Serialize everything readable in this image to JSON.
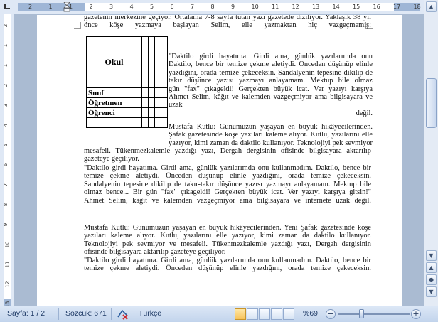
{
  "ruler": {
    "top_numbers": [
      "2",
      "1",
      "1",
      "2",
      "3",
      "4",
      "5",
      "6",
      "7",
      "8",
      "9",
      "10",
      "11",
      "12",
      "13",
      "14",
      "15",
      "16",
      "17",
      "18"
    ],
    "left_numbers": [
      "2",
      "1",
      "1",
      "2",
      "3",
      "4",
      "5",
      "6",
      "7",
      "8",
      "9",
      "10",
      "11",
      "12",
      "13"
    ]
  },
  "document": {
    "intro_lines": [
      "gazetenin merkezine geçiyor. Ortalama 7-8 sayfa tutan yazı gazetede diziliyor. Yaklaşık 38 yıl",
      "önce köşe yazmaya başlayan Selim, elle yazmaktan hiç vazgeçmemiş:"
    ],
    "table": {
      "rows": [
        "Okul",
        "Sınıf",
        "Öğretmen",
        "Öğrenci"
      ]
    },
    "side_quote_lines": [
      "\"Daktilo girdi hayatıma. Girdi ama, günlük yazılarımda onu kullanmadım.",
      "Daktilo, bence bir temize çekme aletiydi. Onceden düşünüp elinle",
      "yazdığını, orada temize çekeceksin. Sandalyenin tepesine dikilip de takır-",
      "takır düşünce yazısı yazmayı anlayamam. Mektup bile olmaz bence... Bir",
      "gün \"fax\" çıkageldi! Gerçekten büyük icat. Ver yazıyı karşıya gitsin!\"",
      "Ahmet Selim, kâğıt ve kalemden vazgeçmiyor ama bilgisayara ve internete",
      "uzak",
      "değil."
    ],
    "p1_lines": [
      "Mustafa Kutlu: Günümüzün yaşayan en büyük hikâyecilerinden. Yeni",
      "Şafak gazetesinde köşe yazıları kaleme alıyor. Kutlu, yazılarını elle",
      "yazıyor, kimi zaman da daktilo kullanıyor. Teknolojiyi pek sevmiyor ve",
      "mesafeli. Tükenmezkalemle yazdığı yazı, Dergah dergisinin ofisinde bilgisayara aktarılıp",
      "gazeteye geçiliyor."
    ],
    "q1_lines": [
      "\"Daktilo girdi hayatıma. Girdi ama, günlük yazılarımda onu kullanmadım. Daktilo, bence bir",
      "temize çekme aletiydi. Önceden düşünüp elinle yazdığını, orada temize çekeceksin.",
      "Sandalyenin tepesine dikilip de takır-takır düşünce yazısı yazmayı anlayamam. Mektup bile",
      "olmaz bence... Bir gün \"fax\" çıkageldi! Gerçekten büyük icat. Ver yazıyı karşıya gitsin!\"",
      "Ahmet Selim, kâğıt ve kalemden vazgeçmiyor ama bilgisayara ve internete uzak değil."
    ],
    "p2_lines": [
      "Mustafa Kutlu: Günümüzün yaşayan en büyük hikâyecilerinden. Yeni Şafak gazetesinde köşe",
      "yazıları kaleme alıyor. Kutlu, yazılarını elle yazıyor, kimi zaman da daktilo kullanıyor.",
      "Teknolojiyi pek sevmiyor ve mesafeli. Tükenmezkalemle yazdığı yazı, Dergah dergisinin",
      "ofisinde bilgisayara aktarılıp gazeteye geçiliyor."
    ],
    "q2_lines": [
      "\"Daktilo girdi hayatıma. Girdi ama, günlük yazılarımda onu kullanmadım. Daktilo, bence bir",
      "temize çekme aletiydi. Önceden düşünüp elinle yazdığını, orada temize çekeceksin."
    ]
  },
  "status_bar": {
    "page": "Sayfa: 1 / 2",
    "words": "Sözcük: 671",
    "language": "Türkçe",
    "zoom": "%69"
  },
  "scrollbar": {
    "up_icon": "▲",
    "down_icon": "▼",
    "prev_icon": "▲",
    "browse_icon": "●",
    "next_icon": "▼"
  },
  "zoom": {
    "minus": "−",
    "plus": "+"
  },
  "colors": {
    "background": "#aabbd2",
    "ruler": "#dfe8f5",
    "status_bar": "#c2d4ec",
    "grammar_underline": "#2b4f9a",
    "spelling_underline": "#2bb34c"
  }
}
